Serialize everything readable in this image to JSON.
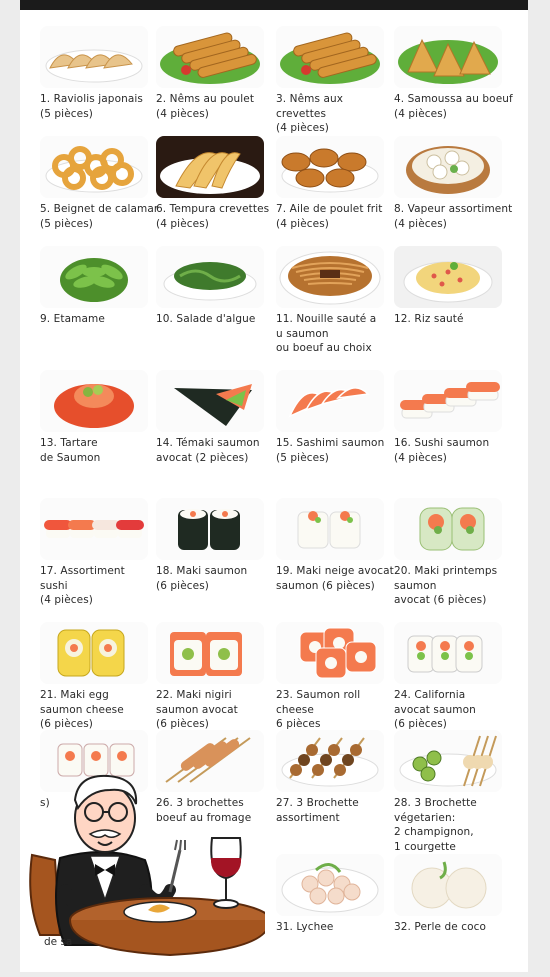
{
  "menu": {
    "items": [
      {
        "label": "1. Raviolis japonais\n(5 pièces)",
        "photo": "gyoza"
      },
      {
        "label": "2. Nêms au poulet\n(4 pièces)",
        "photo": "spring-rolls"
      },
      {
        "label": "3. Nêms aux crevettes\n(4 pièces)",
        "photo": "spring-rolls"
      },
      {
        "label": "4. Samoussa au boeuf\n(4 pièces)",
        "photo": "samosa"
      },
      {
        "label": "5. Beignet de calamar\n(5 pièces)",
        "photo": "calamari"
      },
      {
        "label": "6. Tempura crevettes\n(4 pièces)",
        "photo": "tempura"
      },
      {
        "label": "7. Aile de poulet frit\n(4 pièces)",
        "photo": "chicken-wings"
      },
      {
        "label": "8. Vapeur assortiment\n(4 pièces)",
        "photo": "dim-sum"
      },
      {
        "label": "9. Etamame",
        "photo": "edamame"
      },
      {
        "label": "10. Salade d'algue",
        "photo": "seaweed-salad"
      },
      {
        "label": "11. Nouille sauté a\nu saumon\nou boeuf au choix",
        "photo": "noodles"
      },
      {
        "label": "12. Riz sauté",
        "photo": "fried-rice"
      },
      {
        "label": "13. Tartare\nde Saumon",
        "photo": "tartare"
      },
      {
        "label": "14. Témaki saumon\navocat (2 pièces)",
        "photo": "temaki"
      },
      {
        "label": "15. Sashimi saumon\n(5 pièces)",
        "photo": "sashimi"
      },
      {
        "label": "16. Sushi saumon\n(4 pièces)",
        "photo": "sushi-salmon"
      },
      {
        "label": "17. Assortiment\nsushi\n(4 pièces)",
        "photo": "sushi-assorted"
      },
      {
        "label": "18. Maki saumon\n(6 pièces)",
        "photo": "maki-nori"
      },
      {
        "label": "19. Maki neige avocat\nsaumon (6 pièces)",
        "photo": "maki-white"
      },
      {
        "label": "20. Maki printemps\nsaumon\navocat (6 pièces)",
        "photo": "maki-spring"
      },
      {
        "label": "21. Maki egg\nsaumon cheese\n(6 pièces)",
        "photo": "maki-egg"
      },
      {
        "label": "22. Maki nigiri\nsaumon avocat\n(6 pièces)",
        "photo": "maki-nigiri"
      },
      {
        "label": "23. Saumon roll\ncheese\n6 pièces",
        "photo": "salmon-roll"
      },
      {
        "label": "24. California\navocat saumon\n(6 pièces)",
        "photo": "california"
      },
      {
        "label": "s)",
        "photo": "maki-assorted"
      },
      {
        "label": "26. 3 brochettes\nboeuf au fromage",
        "photo": "skewer-cheese"
      },
      {
        "label": "27.  3 Brochette\nassortiment",
        "photo": "skewer-mix"
      },
      {
        "label": "28. 3 Brochette\nvégetarien:\n2 champignon,\n1 courgette",
        "photo": "skewer-veg"
      },
      {
        "label": "",
        "photo": "hidden"
      },
      {
        "label": "",
        "photo": "hidden"
      },
      {
        "label": "31. Lychee",
        "photo": "lychee"
      },
      {
        "label": "32. Perle de coco",
        "photo": "coconut-pearl"
      }
    ],
    "partial_label": "de sa"
  },
  "colors": {
    "salmon": "#f47a4e",
    "rice": "#fbfaf4",
    "nori": "#1f2a22",
    "greens": "#5fae3a",
    "fried": "#d9953a"
  }
}
